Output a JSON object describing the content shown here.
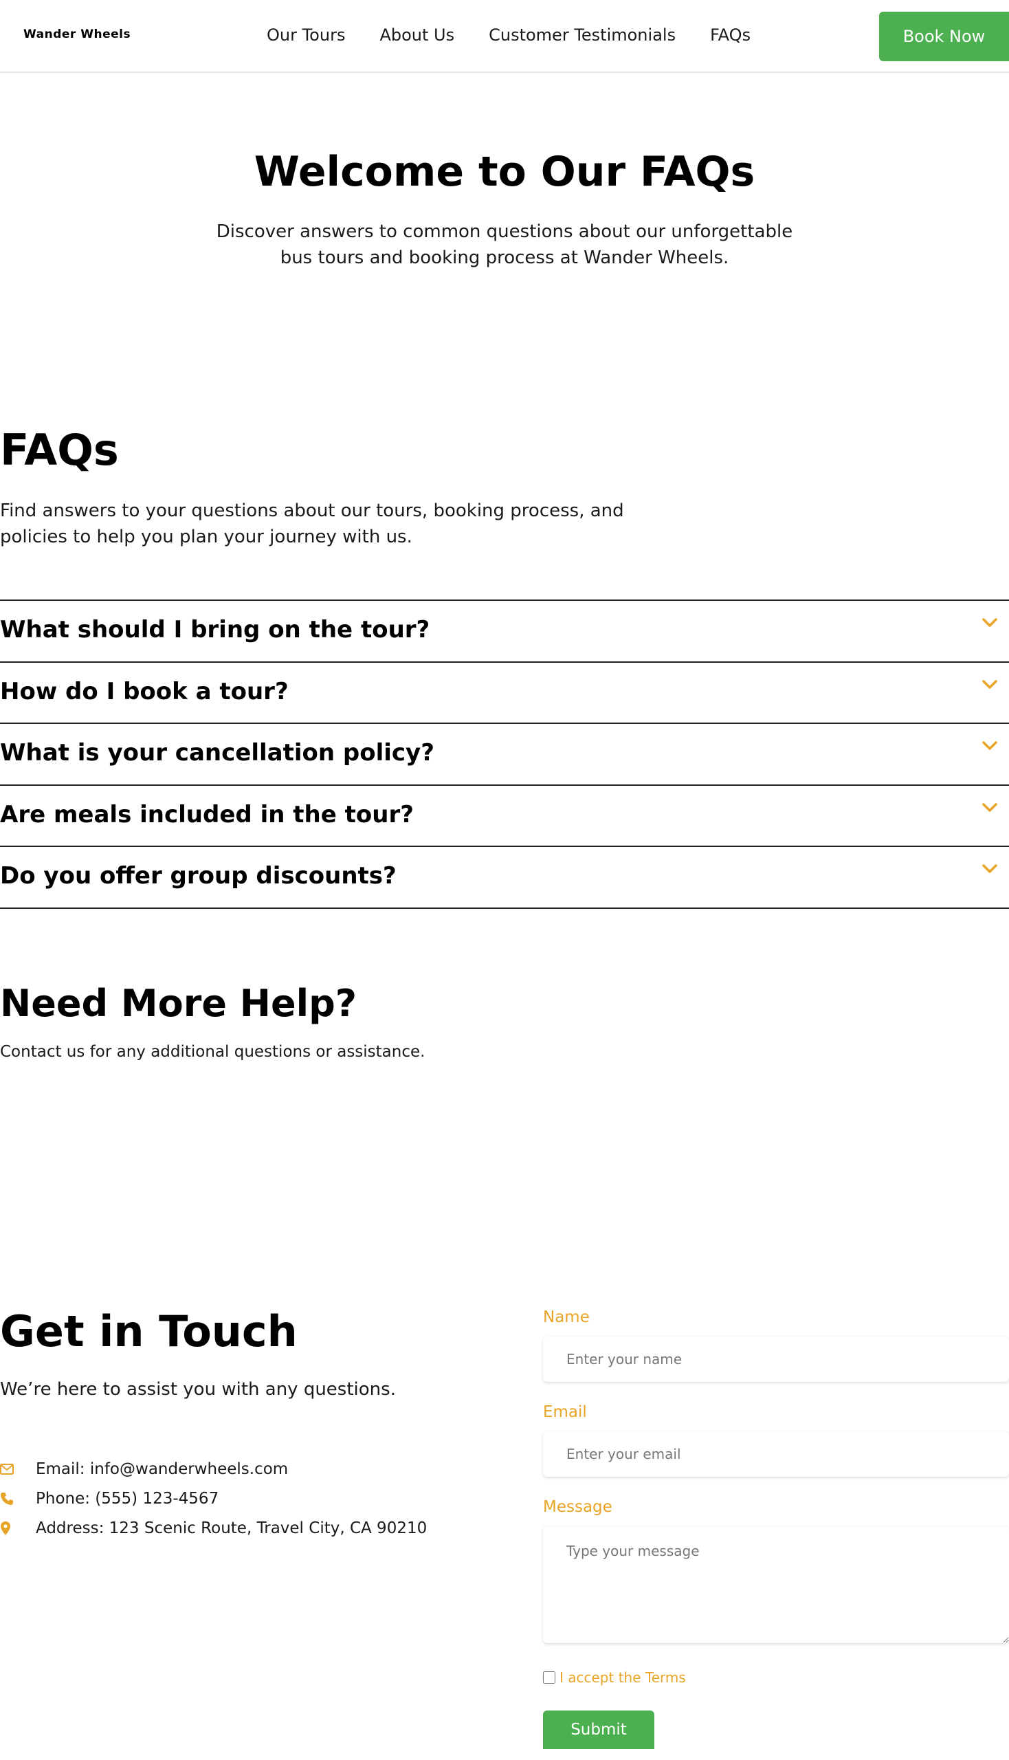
{
  "header": {
    "logo": "Wander Wheels",
    "nav": [
      "Our Tours",
      "About Us",
      "Customer Testimonials",
      "FAQs"
    ],
    "book_label": "Book Now"
  },
  "hero": {
    "title": "Welcome to Our FAQs",
    "subtitle": "Discover answers to common questions about our unforgettable bus tours and booking process at Wander Wheels."
  },
  "faq": {
    "title": "FAQs",
    "subtitle": "Find answers to your questions about our tours, booking process, and policies to help you plan your journey with us.",
    "items": [
      "What should I bring on the tour?",
      "How do I book a tour?",
      "What is your cancellation policy?",
      "Are meals included in the tour?",
      "Do you offer group discounts?"
    ],
    "icon": "chevron-down-icon"
  },
  "help": {
    "title": "Need More Help?",
    "subtitle": "Contact us for any additional questions or assistance."
  },
  "contact": {
    "title": "Get in Touch",
    "subtitle": "We’re here to assist you with any questions.",
    "email": "Email: info@wanderwheels.com",
    "phone": "Phone: (555) 123-4567",
    "address": "Address: 123 Scenic Route, Travel City, CA 90210"
  },
  "form": {
    "name_label": "Name",
    "name_placeholder": "Enter your name",
    "email_label": "Email",
    "email_placeholder": "Enter your email",
    "message_label": "Message",
    "message_placeholder": "Type your message",
    "terms_label": "I accept the Terms",
    "submit_label": "Submit"
  },
  "colors": {
    "accent": "#e8a427",
    "button": "#4caf50",
    "text": "#111111"
  }
}
